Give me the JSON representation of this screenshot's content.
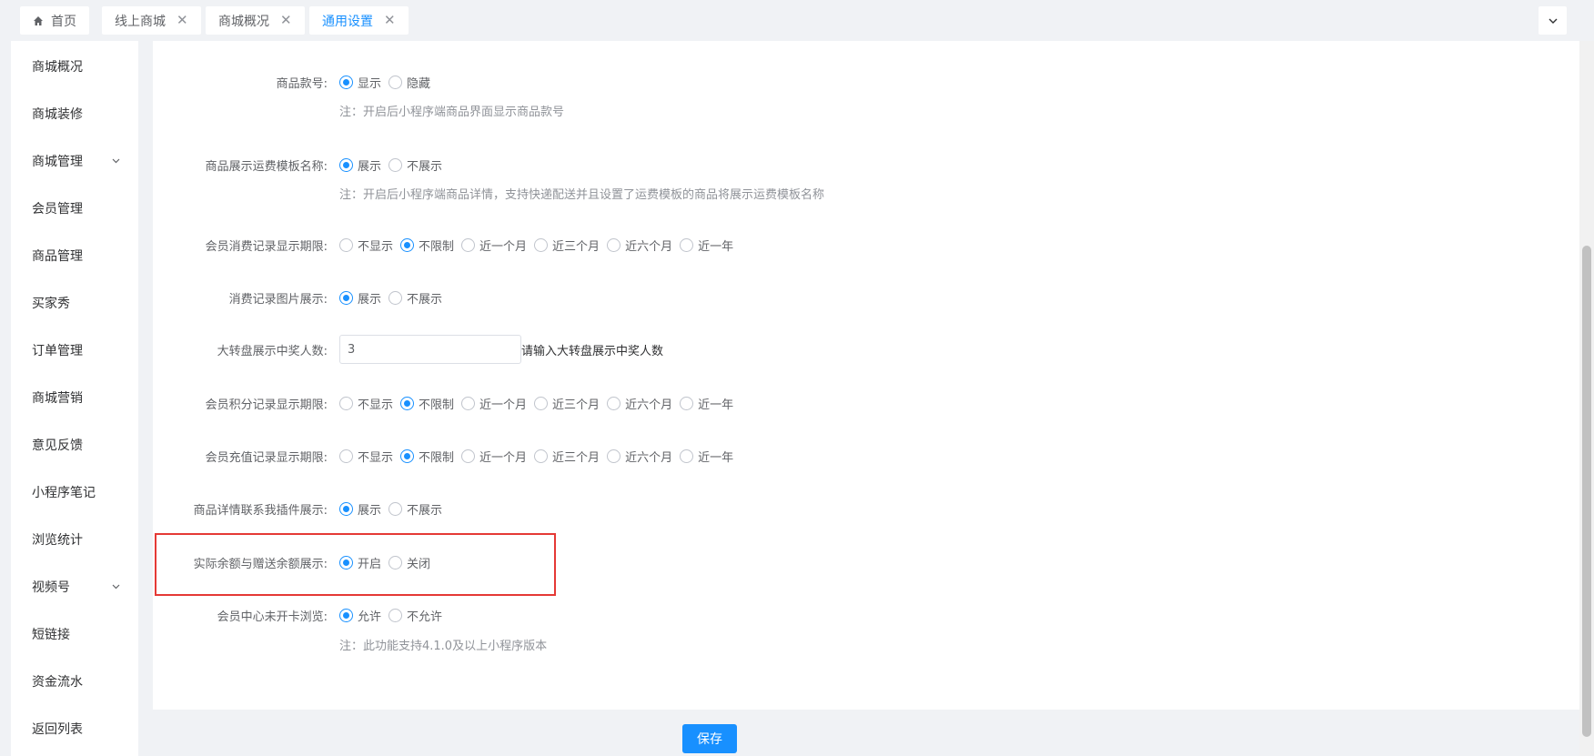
{
  "tabs": [
    {
      "label": "首页",
      "closable": false,
      "active": false,
      "icon": "home-icon"
    },
    {
      "label": "线上商城",
      "closable": true,
      "active": false
    },
    {
      "label": "商城概况",
      "closable": true,
      "active": false
    },
    {
      "label": "通用设置",
      "closable": true,
      "active": true
    }
  ],
  "tab_close_glyph": "✕",
  "sidebar": {
    "items": [
      {
        "label": "商城概况",
        "expandable": false
      },
      {
        "label": "商城装修",
        "expandable": false
      },
      {
        "label": "商城管理",
        "expandable": true
      },
      {
        "label": "会员管理",
        "expandable": false
      },
      {
        "label": "商品管理",
        "expandable": false
      },
      {
        "label": "买家秀",
        "expandable": false
      },
      {
        "label": "订单管理",
        "expandable": false
      },
      {
        "label": "商城营销",
        "expandable": false
      },
      {
        "label": "意见反馈",
        "expandable": false
      },
      {
        "label": "小程序笔记",
        "expandable": false
      },
      {
        "label": "浏览统计",
        "expandable": false
      },
      {
        "label": "视频号",
        "expandable": true
      },
      {
        "label": "短链接",
        "expandable": false
      },
      {
        "label": "资金流水",
        "expandable": false
      },
      {
        "label": "返回列表",
        "expandable": false
      }
    ]
  },
  "form": {
    "goods_no": {
      "label": "商品款号:",
      "options": [
        "显示",
        "隐藏"
      ],
      "selected": 0,
      "note": "注：开启后小程序端商品界面显示商品款号"
    },
    "freight_template": {
      "label": "商品展示运费模板名称:",
      "options": [
        "展示",
        "不展示"
      ],
      "selected": 0,
      "note": "注：开启后小程序端商品详情，支持快递配送并且设置了运费模板的商品将展示运费模板名称"
    },
    "consume_period": {
      "label": "会员消费记录显示期限:",
      "options": [
        "不显示",
        "不限制",
        "近一个月",
        "近三个月",
        "近六个月",
        "近一年"
      ],
      "selected": 1
    },
    "consume_image": {
      "label": "消费记录图片展示:",
      "options": [
        "展示",
        "不展示"
      ],
      "selected": 0
    },
    "wheel_winners": {
      "label": "大转盘展示中奖人数:",
      "value": "3",
      "hint": "请输入大转盘展示中奖人数"
    },
    "points_period": {
      "label": "会员积分记录显示期限:",
      "options": [
        "不显示",
        "不限制",
        "近一个月",
        "近三个月",
        "近六个月",
        "近一年"
      ],
      "selected": 1
    },
    "recharge_period": {
      "label": "会员充值记录显示期限:",
      "options": [
        "不显示",
        "不限制",
        "近一个月",
        "近三个月",
        "近六个月",
        "近一年"
      ],
      "selected": 1
    },
    "contact_plugin": {
      "label": "商品详情联系我插件展示:",
      "options": [
        "展示",
        "不展示"
      ],
      "selected": 0
    },
    "balance_display": {
      "label": "实际余额与赠送余额展示:",
      "options": [
        "开启",
        "关闭"
      ],
      "selected": 0
    },
    "member_browse": {
      "label": "会员中心未开卡浏览:",
      "options": [
        "允许",
        "不允许"
      ],
      "selected": 0,
      "note": "注：此功能支持4.1.0及以上小程序版本"
    }
  },
  "save_label": "保存",
  "colors": {
    "primary": "#1890ff",
    "highlight": "#e53935"
  }
}
